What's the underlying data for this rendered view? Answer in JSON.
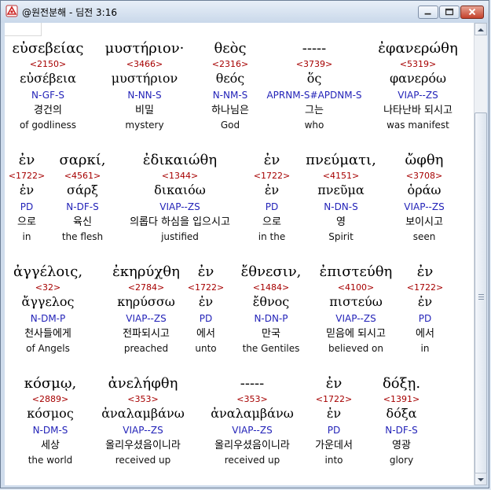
{
  "window": {
    "title": "@원전분해 - 딤전 3:16",
    "controls": {
      "min": "minimize-icon",
      "max": "maximize-icon",
      "close": "close-icon"
    }
  },
  "rows": [
    {
      "words": [
        {
          "greek": "εὐσεβείας",
          "strong": "<2150>",
          "lemma": "εὐσέβεια",
          "morph": "N-GF-S",
          "korean": "경건의",
          "english": "of godliness"
        },
        {
          "greek": "μυστήριον·",
          "strong": "<3466>",
          "lemma": "μυστήριον",
          "morph": "N-NN-S",
          "korean": "비밀",
          "english": "mystery"
        },
        {
          "greek": "θεὸς",
          "strong": "<2316>",
          "lemma": "θεός",
          "morph": "N-NM-S",
          "korean": "하나님은",
          "english": "God"
        },
        {
          "greek": "-----",
          "strong": "<3739>",
          "lemma": "ὅς",
          "morph": "APRNM-S#APDNM-S",
          "korean": "그는",
          "english": "who"
        },
        {
          "greek": "ἐφανερώθη",
          "strong": "<5319>",
          "lemma": "φανερόω",
          "morph": "VIAP--ZS",
          "korean": "나타난바 되시고",
          "english": "was manifest"
        }
      ]
    },
    {
      "words": [
        {
          "greek": "ἐν",
          "strong": "<1722>",
          "lemma": "ἐν",
          "morph": "PD",
          "korean": "으로",
          "english": "in"
        },
        {
          "greek": "σαρκί,",
          "strong": "<4561>",
          "lemma": "σάρξ",
          "morph": "N-DF-S",
          "korean": "육신",
          "english": "the flesh"
        },
        {
          "greek": "ἐδικαιώθη",
          "strong": "<1344>",
          "lemma": "δικαιόω",
          "morph": "VIAP--ZS",
          "korean": "의롭다 하심을 입으시고",
          "english": "justified"
        },
        {
          "greek": "ἐν",
          "strong": "<1722>",
          "lemma": "ἐν",
          "morph": "PD",
          "korean": "으로",
          "english": "in the"
        },
        {
          "greek": "πνεύματι,",
          "strong": "<4151>",
          "lemma": "πνεῦμα",
          "morph": "N-DN-S",
          "korean": "영",
          "english": "Spirit"
        },
        {
          "greek": "ὤφθη",
          "strong": "<3708>",
          "lemma": "ὁράω",
          "morph": "VIAP--ZS",
          "korean": "보이시고",
          "english": "seen"
        }
      ]
    },
    {
      "words": [
        {
          "greek": "ἀγγέλοις,",
          "strong": "<32>",
          "lemma": "ἄγγελος",
          "morph": "N-DM-P",
          "korean": "천사들에게",
          "english": "of Angels"
        },
        {
          "greek": "ἐκηρύχθη",
          "strong": "<2784>",
          "lemma": "κηρύσσω",
          "morph": "VIAP--ZS",
          "korean": "전파되시고",
          "english": "preached"
        },
        {
          "greek": "ἐν",
          "strong": "<1722>",
          "lemma": "ἐν",
          "morph": "PD",
          "korean": "에서",
          "english": "unto"
        },
        {
          "greek": "ἔθνεσιν,",
          "strong": "<1484>",
          "lemma": "ἔθνος",
          "morph": "N-DN-P",
          "korean": "만국",
          "english": "the Gentiles"
        },
        {
          "greek": "ἐπιστεύθη",
          "strong": "<4100>",
          "lemma": "πιστεύω",
          "morph": "VIAP--ZS",
          "korean": "믿음에 되시고",
          "english": "believed on"
        },
        {
          "greek": "ἐν",
          "strong": "<1722>",
          "lemma": "ἐν",
          "morph": "PD",
          "korean": "에서",
          "english": "in"
        }
      ]
    },
    {
      "words": [
        {
          "greek": "κόσμῳ,",
          "strong": "<2889>",
          "lemma": "κόσμος",
          "morph": "N-DM-S",
          "korean": "세상",
          "english": "the world"
        },
        {
          "greek": "ἀνελήφθη",
          "strong": "<353>",
          "lemma": "ἀναλαμβάνω",
          "morph": "VIAP--ZS",
          "korean": "올리우셨음이니라",
          "english": "received up"
        },
        {
          "greek": "-----",
          "strong": "<353>",
          "lemma": "ἀναλαμβάνω",
          "morph": "VIAP--ZS",
          "korean": "올리우셨음이니라",
          "english": "received up"
        },
        {
          "greek": "ἐν",
          "strong": "<1722>",
          "lemma": "ἐν",
          "morph": "PD",
          "korean": "가운데서",
          "english": "into"
        },
        {
          "greek": "δόξῃ.",
          "strong": "<1391>",
          "lemma": "δόξα",
          "morph": "N-DF-S",
          "korean": "영광",
          "english": "glory"
        }
      ]
    }
  ],
  "colors": {
    "strong": "#a60000",
    "morph": "#2323b8"
  }
}
